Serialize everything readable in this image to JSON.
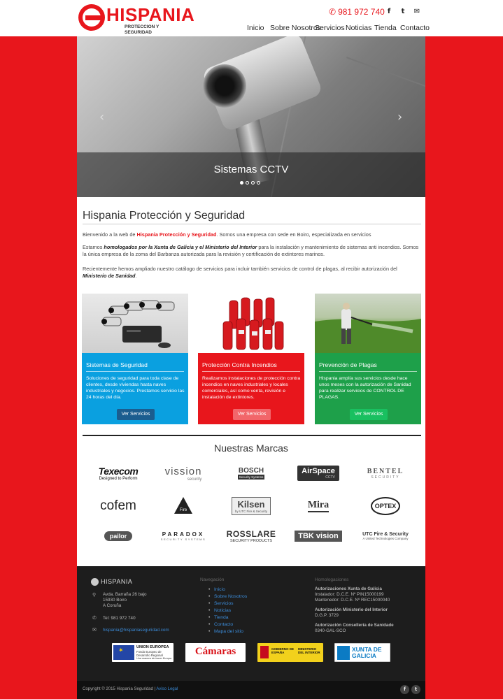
{
  "header": {
    "logo_name": "HISPANIA",
    "logo_tagline": "PROTECCION Y SEGURIDAD",
    "phone": "981 972 740",
    "phone_icon": "phone-icon",
    "social": [
      {
        "name": "facebook-icon",
        "glyph": "f"
      },
      {
        "name": "twitter-icon",
        "glyph": "t"
      },
      {
        "name": "mail-icon",
        "glyph": "✉"
      }
    ],
    "nav": [
      "Inicio",
      "Sobre Nosotros",
      "Servicios",
      "Noticias",
      "Tienda",
      "Contacto"
    ]
  },
  "slider": {
    "caption": "Sistemas CCTV",
    "prev_icon": "chevron-left-icon",
    "next_icon": "chevron-right-icon",
    "slide_count": 4,
    "active_slide": 1
  },
  "intro": {
    "title": "Hispania Protección y Seguridad",
    "p1_pre": "Bienvenido a la web de ",
    "p1_strong": "Hispania Protección y Seguridad",
    "p1_post": ". Somos una empresa con sede en Boiro, especializada en servicios",
    "p2_pre": "Estamos ",
    "p2_strong1": "homologados por la Xunta de Galicia y el Ministerio del Interior",
    "p2_post": " para la instalación y mantenimiento de sistemas anti incendios. Somos la única empresa de la zoma del Barbanza autorizada para la revisión y certificación de extintores marinos.",
    "p3_pre": "Recientemente hemos ampliado nuestro catálogo de servicios para incluir también servicios de control de plagas, al recibir autorización del ",
    "p3_strong": "Ministerio de Sanidad",
    "p3_post": "."
  },
  "services": [
    {
      "title": "Sistemas de Seguridad",
      "text": "Soluciones de seguridad para toda clase de clientes, desde viviendas hasta naves industriales y negocios. Prestamos servicio las 24 horas del día.",
      "button": "Ver Servicios",
      "color": "#0aa0e0",
      "btn_color": "#1b5d8f"
    },
    {
      "title": "Protección Contra Incendios",
      "text": "Realizamos instalaciones de protección contra incendios en naves industriales y locales comerciales, así como venta, revisión e instalación de extintores.",
      "button": "Ver Servicios",
      "color": "#e8161c",
      "btn_color": "#f2666a"
    },
    {
      "title": "Prevención de Plagas",
      "text": "Hispania amplía sus servicios desde hace unos meses con la autorización de Sanidad para realizar servicios de CONTROL DE PLAGAS.",
      "button": "Ver Servicios",
      "color": "#1ea04a",
      "btn_color": "#19c060"
    }
  ],
  "brands": {
    "title": "Nuestras Marcas",
    "items": [
      "Texecom",
      "vission",
      "BOSCH",
      "AirSpace",
      "BENTEL",
      "cofem",
      "Fire",
      "Kilsen",
      "Mira",
      "OPTEX",
      "pailor",
      "PARADOX",
      "ROSSLARE",
      "TBK vision",
      "UTC Fire & Security"
    ],
    "subs": {
      "Texecom": "Designed to Perform",
      "vission": "security",
      "BOSCH": "Security Systems",
      "AirSpace": "CCTV",
      "BENTEL": "SECURITY",
      "Kilsen": "by UTC Fire & Security",
      "OPTEX": "",
      "ROSSLARE": "SECURITY PRODUCTS",
      "PARADOX": "SECURITY SYSTEMS",
      "UTC Fire & Security": "A United Technologies Company"
    }
  },
  "footer": {
    "logo": "HISPANIA",
    "address_icon": "location-icon",
    "address": [
      "Avda. Barraña 26 bajo",
      "15930 Boiro",
      "A Coruña"
    ],
    "tel_icon": "phone-icon",
    "tel": "Tel: 981 972 740",
    "email_icon": "mail-icon",
    "email": "hispania@hispaniaseguridad.com",
    "nav_title": "Navegación",
    "nav_links": [
      "Inicio",
      "Sobre Nosotros",
      "Servicios",
      "Noticias",
      "Tienda",
      "Contacto",
      "Mapa del sitio"
    ],
    "hom_title": "Homologaciones",
    "hom": [
      {
        "title": "Autorizaciones Xunta de Galicia",
        "lines": [
          "Instalador: D.C.E. Nº PIN15000199",
          "Mantenedor: D.C.E. Nº REC15000040"
        ]
      },
      {
        "title": "Autorización Ministerio del Interior",
        "lines": [
          "D.G.P. 3729"
        ]
      },
      {
        "title": "Autorización Consellería de Sanidade",
        "lines": [
          "0340-GAL-SCO"
        ]
      }
    ],
    "sponsors": [
      {
        "name": "UNION EUROPEA",
        "sub": "Fondo Europeo de Desarrollo Regional",
        "sub2": "Una manera de hacer Europa"
      },
      {
        "name": "Cámaras"
      },
      {
        "name": "GOBIERNO DE ESPAÑA",
        "sub": "MINISTERIO DEL INTERIOR"
      },
      {
        "name": "XUNTA DE GALICIA"
      }
    ]
  },
  "bottom": {
    "copyright": "Copyright © 2015 Hispania Seguridad | ",
    "legal": "Aviso Legal",
    "social": [
      {
        "name": "facebook-icon",
        "glyph": "f"
      },
      {
        "name": "twitter-icon",
        "glyph": "t"
      }
    ]
  }
}
